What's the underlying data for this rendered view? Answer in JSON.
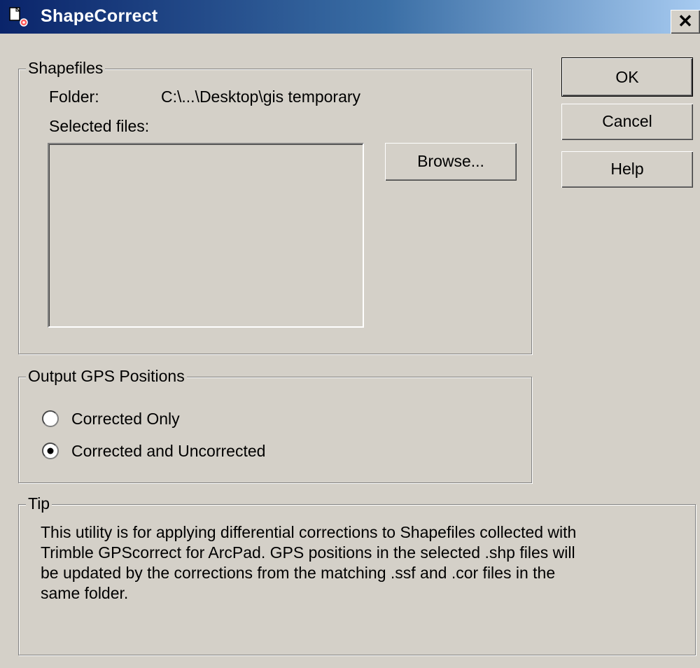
{
  "window": {
    "title": "ShapeCorrect",
    "close_symbol": "✕"
  },
  "shapefiles": {
    "legend": "Shapefiles",
    "folder_label": "Folder:",
    "folder_path": "C:\\...\\Desktop\\gis temporary",
    "selected_files_label": "Selected files:",
    "browse_label": "Browse..."
  },
  "buttons": {
    "ok": "OK",
    "cancel": "Cancel",
    "help": "Help"
  },
  "output": {
    "legend": "Output GPS Positions",
    "options": [
      {
        "label": "Corrected Only",
        "checked": false
      },
      {
        "label": "Corrected and Uncorrected",
        "checked": true
      }
    ]
  },
  "tip": {
    "legend": "Tip",
    "text": "This utility is for applying differential corrections to Shapefiles collected with\nTrimble GPScorrect for ArcPad.  GPS positions in the selected .shp files will\nbe updated by the corrections from the matching .ssf and .cor files in the\nsame folder."
  }
}
